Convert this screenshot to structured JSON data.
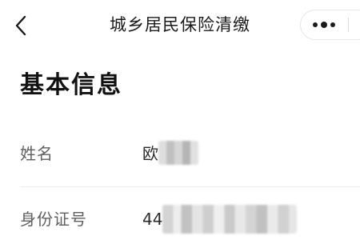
{
  "navbar": {
    "back_icon": "chevron-left-icon",
    "title": "城乡居民保险清缴",
    "more_icon": "more-dots-icon"
  },
  "section": {
    "title": "基本信息"
  },
  "fields": {
    "name": {
      "label": "姓名",
      "value_visible": "欧"
    },
    "id_number": {
      "label": "身份证号",
      "value_visible": "44"
    }
  },
  "colors": {
    "background": "#ffffff",
    "text_primary": "#1a1a1a",
    "text_label": "#5f5f5f",
    "divider": "#ececec"
  }
}
